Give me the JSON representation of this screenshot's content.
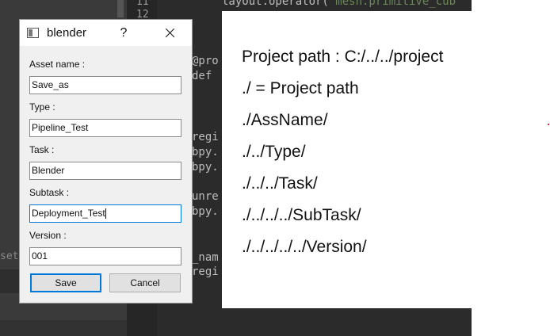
{
  "dialog": {
    "title": "blender",
    "help_label": "?",
    "fields": [
      {
        "label": "Asset name :",
        "value": "Save_as"
      },
      {
        "label": "Type :",
        "value": "Pipeline_Test"
      },
      {
        "label": "Task :",
        "value": "Blender"
      },
      {
        "label": "Subtask :",
        "value": "Deployment_Test"
      },
      {
        "label": "Version :",
        "value": "001"
      }
    ],
    "save_label": "Save",
    "cancel_label": "Cancel"
  },
  "info_panel": {
    "lines": [
      "Project path : C:/../../project",
      "./ = Project path",
      "./AssName/",
      "./../Type/",
      "./../../Task/",
      "./../../../SubTask/",
      "./../../../../Version/"
    ]
  },
  "background_editor": {
    "line_numbers": [
      "11",
      "12"
    ],
    "left_fragment": "set",
    "code_fragments": {
      "top": "layout.operator(",
      "top_string": "'mesh.primitive_cub",
      "deco": "@pro",
      "def": "def",
      "regi1": "regi",
      "bpy1": "bpy.",
      "bpy2": "bpy.",
      "unreg": "unre",
      "bpy3": "bpy.",
      "nam": "_nam",
      "regi2": "regi"
    }
  },
  "colors": {
    "editor_bg": "#2b2b2b",
    "dialog_bg": "#f0f0f0",
    "focus_blue": "#0078d7"
  }
}
